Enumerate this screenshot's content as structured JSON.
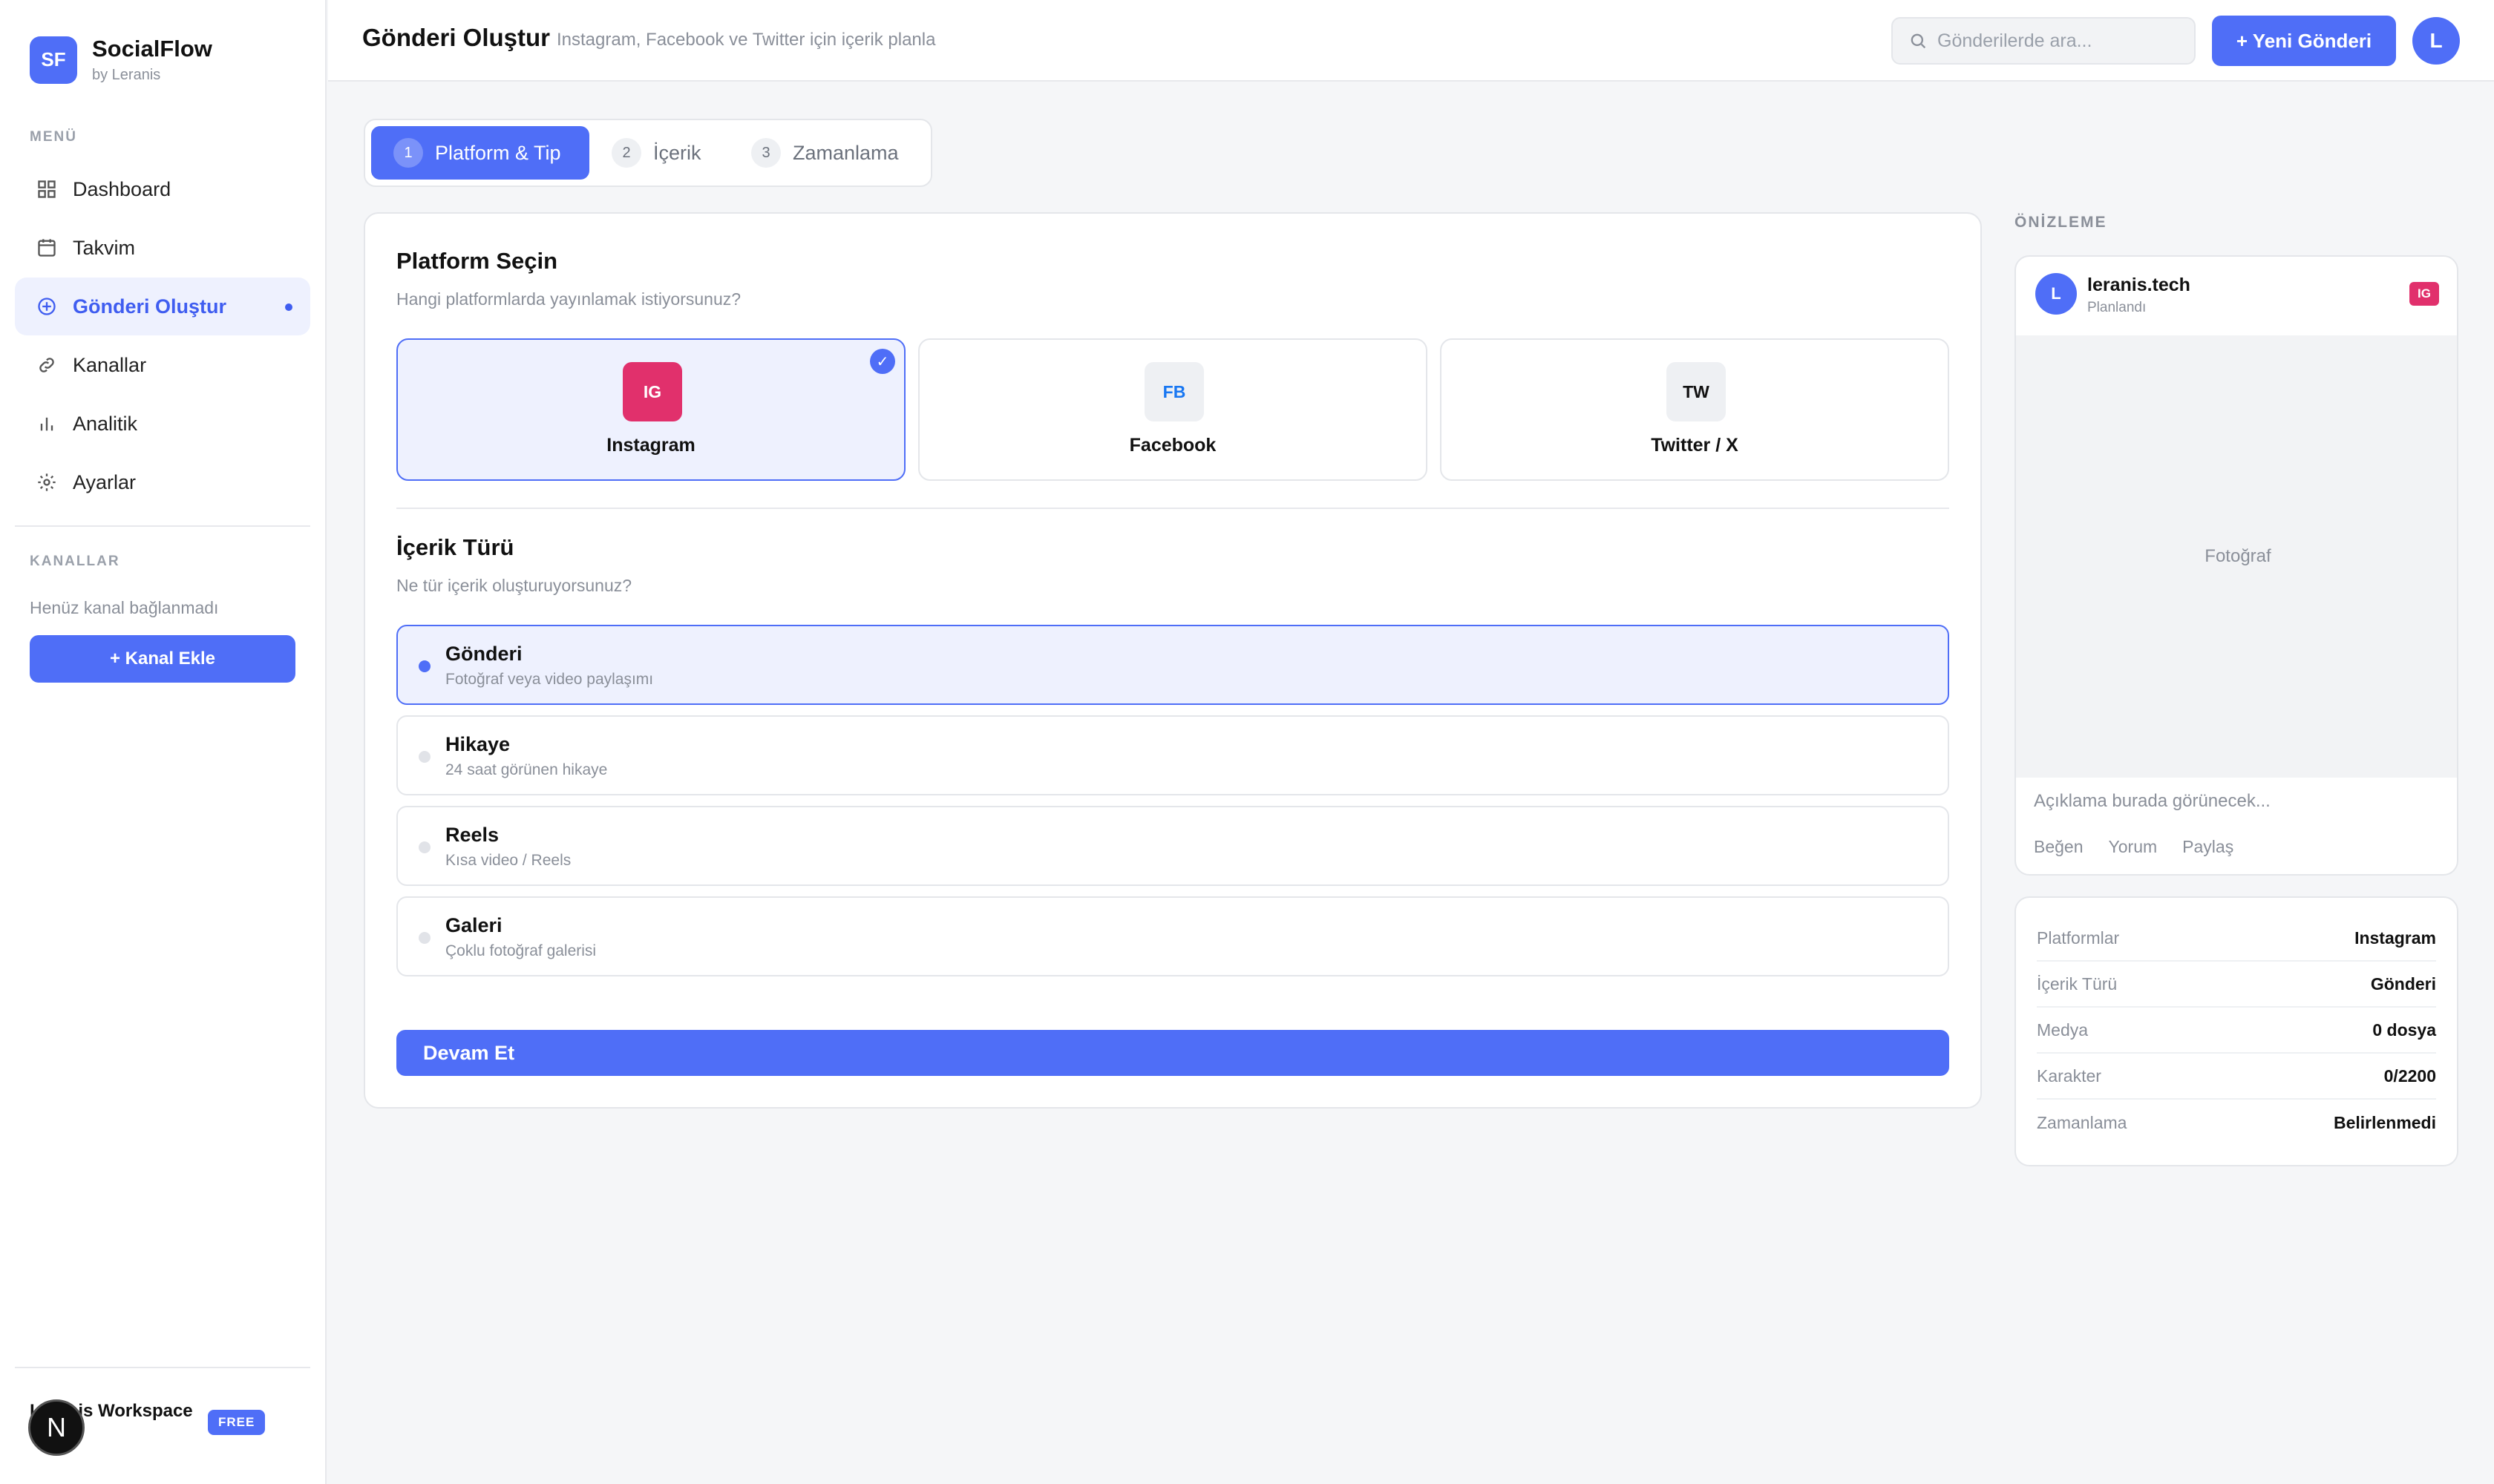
{
  "brand": {
    "logo": "SF",
    "name": "SocialFlow",
    "sub": "by Leranis"
  },
  "sidebar": {
    "menu_label": "MENÜ",
    "items": [
      {
        "label": "Dashboard",
        "icon": "grid-icon"
      },
      {
        "label": "Takvim",
        "icon": "calendar-icon"
      },
      {
        "label": "Gönderi Oluştur",
        "icon": "plus-circle-icon",
        "active": true
      },
      {
        "label": "Kanallar",
        "icon": "link-icon"
      },
      {
        "label": "Analitik",
        "icon": "bar-chart-icon"
      },
      {
        "label": "Ayarlar",
        "icon": "gear-icon"
      }
    ],
    "channels_label": "KANALLAR",
    "empty_channels": "Henüz kanal bağlanmadı",
    "add_channel": "+ Kanal Ekle",
    "workspace": "Leranis Workspace",
    "plan": "FREE",
    "dev_badge": "N"
  },
  "header": {
    "title": "Gönderi Oluştur",
    "subtitle": "Instagram, Facebook ve Twitter için içerik planla",
    "search_placeholder": "Gönderilerde ara...",
    "new_post": "+ Yeni Gönderi",
    "avatar": "L"
  },
  "steps": [
    {
      "num": "1",
      "label": "Platform & Tip",
      "active": true
    },
    {
      "num": "2",
      "label": "İçerik"
    },
    {
      "num": "3",
      "label": "Zamanlama"
    }
  ],
  "platform_section": {
    "title": "Platform Seçin",
    "subtitle": "Hangi platformlarda yayınlamak istiyorsunuz?",
    "platforms": [
      {
        "code": "IG",
        "name": "Instagram",
        "selected": true,
        "color": "#e1306c"
      },
      {
        "code": "FB",
        "name": "Facebook",
        "selected": false,
        "color": "#1877f2"
      },
      {
        "code": "TW",
        "name": "Twitter / X",
        "selected": false,
        "color": "#111111"
      }
    ],
    "check": "✓"
  },
  "content_section": {
    "title": "İçerik Türü",
    "subtitle": "Ne tür içerik oluşturuyorsunuz?",
    "types": [
      {
        "title": "Gönderi",
        "desc": "Fotoğraf veya video paylaşımı",
        "selected": true
      },
      {
        "title": "Hikaye",
        "desc": "24 saat görünen hikaye"
      },
      {
        "title": "Reels",
        "desc": "Kısa video / Reels"
      },
      {
        "title": "Galeri",
        "desc": "Çoklu fotoğraf galerisi"
      }
    ]
  },
  "continue": "Devam Et",
  "preview": {
    "label": "ÖNİZLEME",
    "avatar": "L",
    "account": "leranis.tech",
    "status": "Planlandı",
    "badge": "IG",
    "media_placeholder": "Fotoğraf",
    "caption": "Açıklama burada görünecek...",
    "actions": [
      "Beğen",
      "Yorum",
      "Paylaş"
    ]
  },
  "summary": [
    {
      "key": "Platformlar",
      "value": "Instagram"
    },
    {
      "key": "İçerik Türü",
      "value": "Gönderi"
    },
    {
      "key": "Medya",
      "value": "0 dosya"
    },
    {
      "key": "Karakter",
      "value": "0/2200"
    },
    {
      "key": "Zamanlama",
      "value": "Belirlenmedi"
    }
  ],
  "colors": {
    "accent": "#4f6ef7",
    "instagram": "#e1306c"
  }
}
